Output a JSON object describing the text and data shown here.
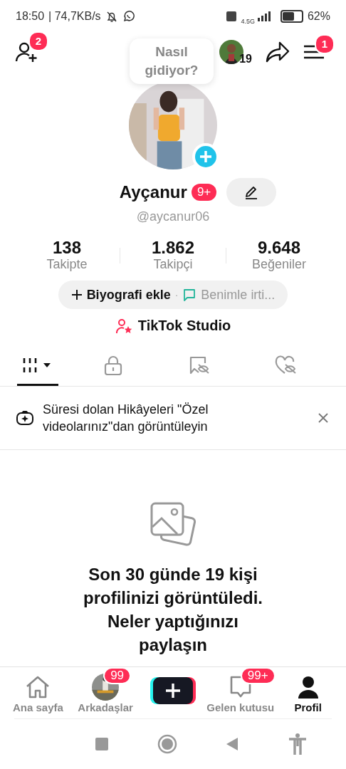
{
  "status_bar": {
    "time": "18:50",
    "speed": "| 74,7KB/s",
    "network": "4.5G",
    "battery_percent": "62%"
  },
  "top_bar": {
    "add_friends_badge": "2",
    "viewers_count": "19",
    "menu_badge": "1"
  },
  "profile": {
    "bubble": "Nasıl gidiyor?",
    "name": "Ayçanur",
    "name_badge": "9+",
    "handle": "@aycanur06",
    "stats": [
      {
        "value": "138",
        "label": "Takipte"
      },
      {
        "value": "1.862",
        "label": "Takipçi"
      },
      {
        "value": "9.648",
        "label": "Beğeniler"
      }
    ],
    "bio_button": "Biyografi ekle",
    "separator": "·",
    "contact_button": "Benimle irti...",
    "studio_link": "TikTok Studio"
  },
  "tabs": [
    {
      "kind": "grid",
      "selected": true
    },
    {
      "kind": "lock",
      "selected": false
    },
    {
      "kind": "bookmark",
      "selected": false
    },
    {
      "kind": "heart",
      "selected": false
    }
  ],
  "notice": {
    "text": "Süresi dolan Hikâyeleri \"Özel videolarınız\"dan görüntüleyin"
  },
  "empty_state": {
    "text": "Son 30 günde 19 kişi profilinizi görüntüledi. Neler yaptığınızı paylaşın"
  },
  "bottom_nav": [
    {
      "kind": "home",
      "label": "Ana sayfa",
      "selected": false
    },
    {
      "kind": "friends",
      "label": "Arkadaşlar",
      "badge": "99",
      "selected": false
    },
    {
      "kind": "create",
      "selected": false
    },
    {
      "kind": "inbox",
      "label": "Gelen kutusu",
      "badge": "99+",
      "selected": false
    },
    {
      "kind": "profile",
      "label": "Profil",
      "selected": true
    }
  ]
}
